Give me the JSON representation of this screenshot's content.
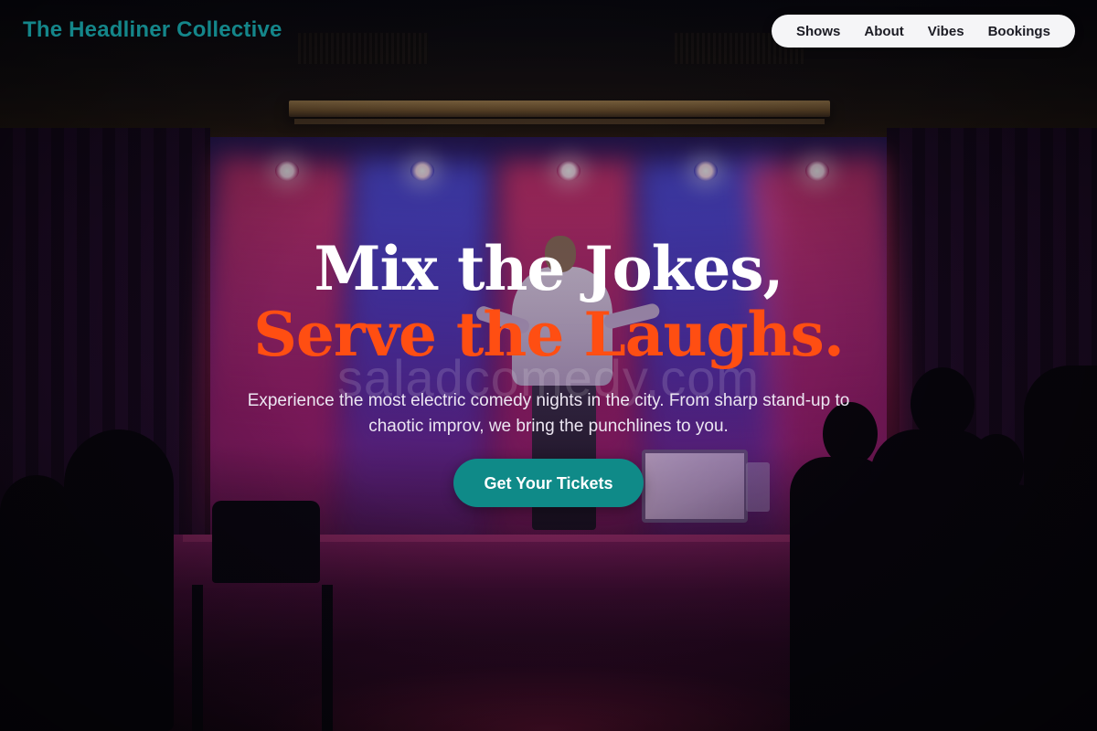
{
  "header": {
    "brand": "The Headliner Collective",
    "nav": [
      "Shows",
      "About",
      "Vibes",
      "Bookings"
    ]
  },
  "hero": {
    "headline_line1": "Mix the Jokes,",
    "headline_line2": "Serve the Laughs.",
    "subtitle": "Experience the most electric comedy nights in the city. From sharp stand-up to chaotic improv, we bring the punchlines to you.",
    "cta_label": "Get Your Tickets",
    "watermark": "saladcomedy.com"
  },
  "colors": {
    "brand": "#14868a",
    "accent": "#ff4e12",
    "cta_background": "#0f8a88",
    "nav_background": "#f5f5f7"
  }
}
